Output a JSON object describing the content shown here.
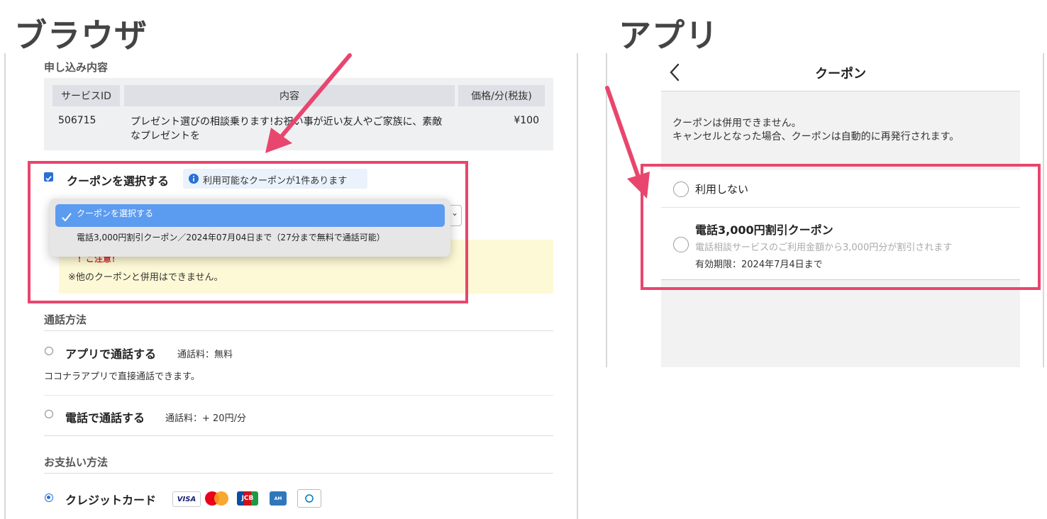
{
  "labels": {
    "browser": "ブラウザ",
    "app": "アプリ"
  },
  "browser": {
    "order_section_title": "申し込み内容",
    "table": {
      "headers": [
        "サービスID",
        "内容",
        "価格/分(税抜)"
      ],
      "row": {
        "id": "506715",
        "content_line1": "プレゼント選びの相談乗ります!お祝い事が近い友人やご家族に、素敵",
        "content_line2": "なプレゼントを",
        "price": "¥100"
      }
    },
    "coupon": {
      "checkbox_label": "クーポンを選択する",
      "info_badge": "利用可能なクーポンが1件あります",
      "dropdown": {
        "selected": "クーポンを選択する",
        "option": "電話3,000円割引クーポン／2024年07月04日まで（27分まで無料で通話可能）"
      },
      "notice_title": "！ご注意！",
      "notice_text": "※他のクーポンと併用はできません。"
    },
    "call_section_title": "通話方法",
    "call_app": {
      "label": "アプリで通話する",
      "fee": "通話料：無料",
      "desc": "ココナラアプリで直接通話できます。"
    },
    "call_phone": {
      "label": "電話で通話する",
      "fee": "通話料：+ 20円/分"
    },
    "payment_section_title": "お支払い方法",
    "payment_credit": "クレジットカード",
    "cards": [
      "VISA",
      "mastercard",
      "JCB",
      "AMEX",
      "Diners Club"
    ]
  },
  "app": {
    "header_title": "クーポン",
    "notice_line1": "クーポンは併用できません。",
    "notice_line2": "キャンセルとなった場合、クーポンは自動的に再発行されます。",
    "option_none": "利用しない",
    "coupon_title": "電話3,000円割引クーポン",
    "coupon_desc": "電話相談サービスのご利用金額から3,000円分が割引されます",
    "coupon_expiry": "有効期限：2024年7月4日まで"
  },
  "colors": {
    "highlight": "#e8466e",
    "accent": "#2a6fd6",
    "notice_bg": "#fdf9d6"
  }
}
